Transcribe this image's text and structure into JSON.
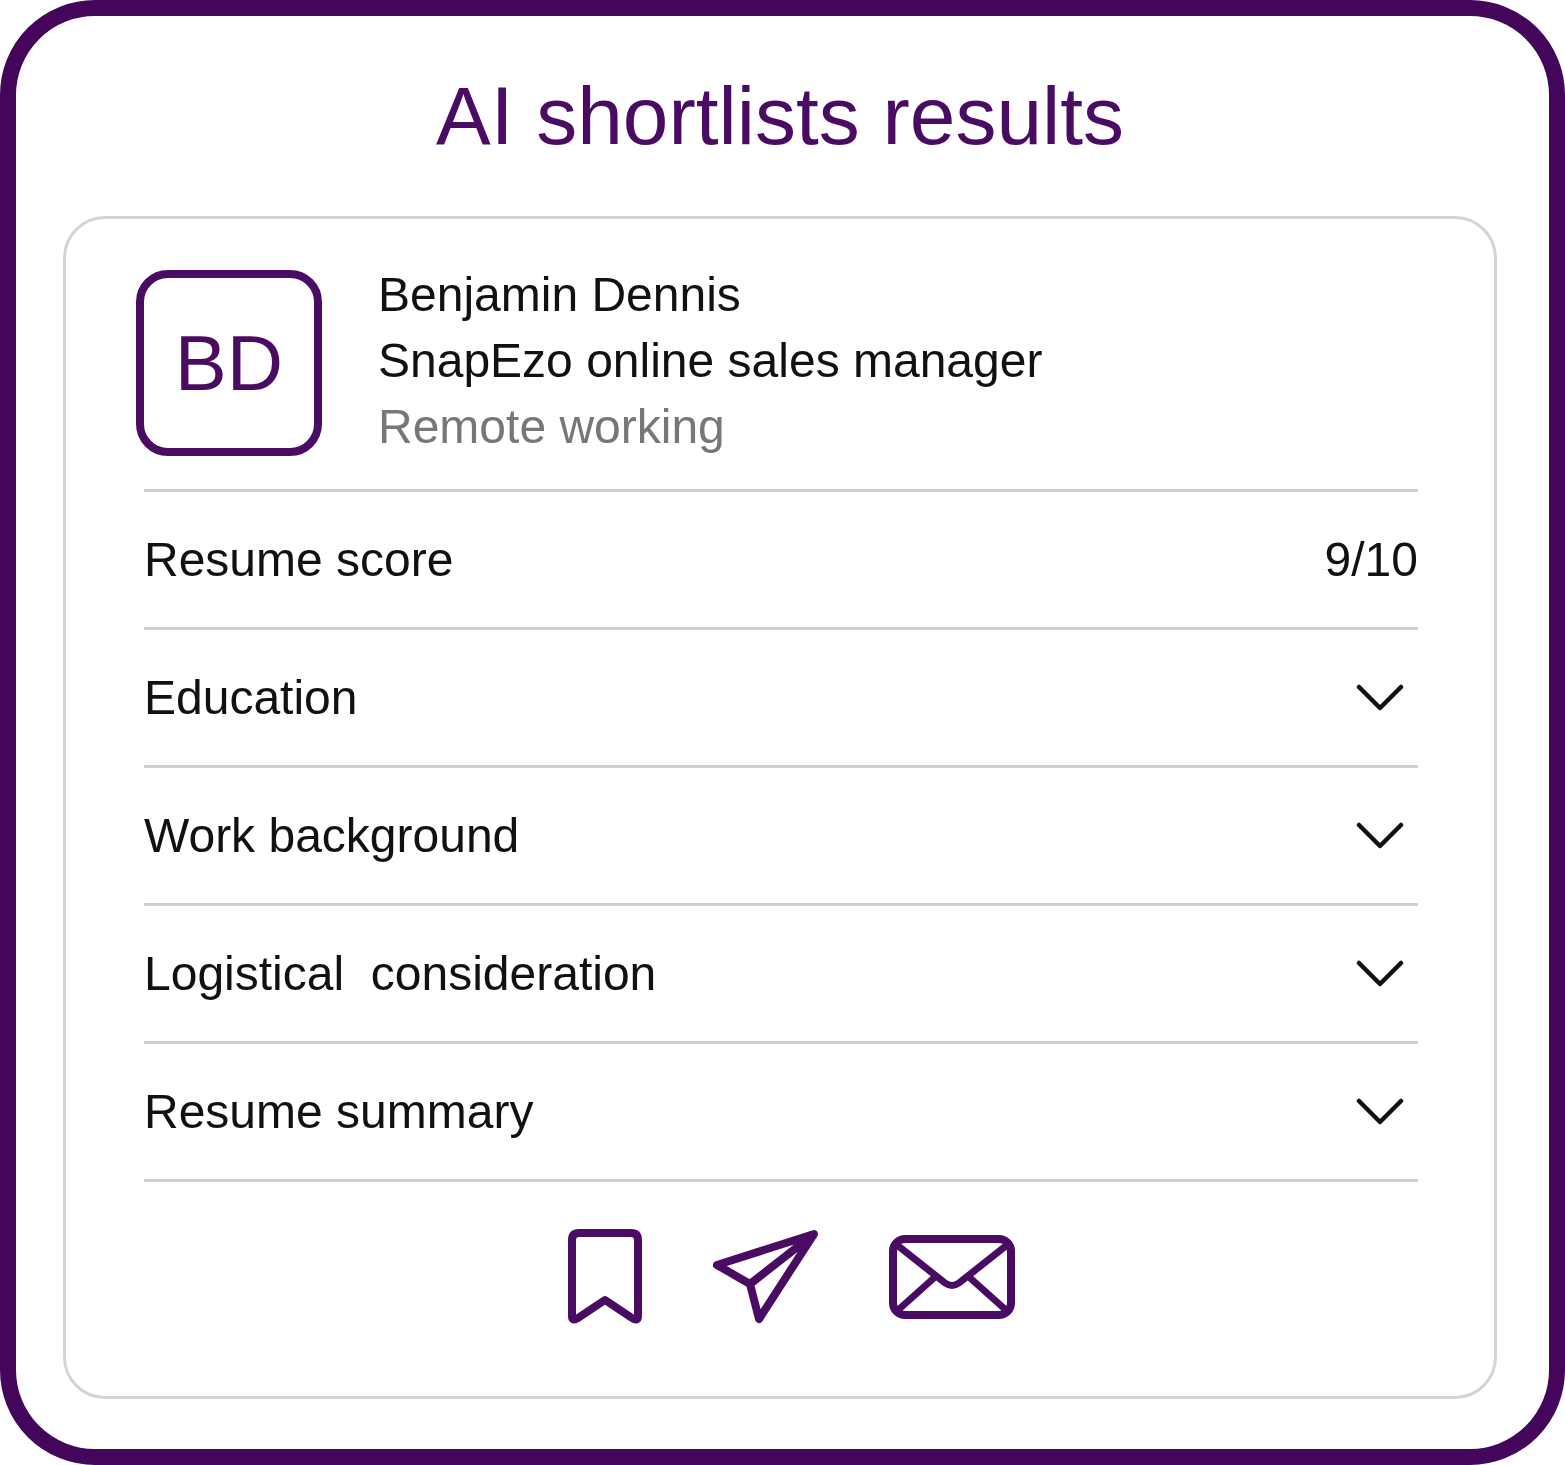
{
  "title": "AI shortlists results",
  "candidate": {
    "initials": "BD",
    "name": "Benjamin Dennis",
    "role": "SnapEzo online sales manager",
    "location": "Remote working"
  },
  "rows": [
    {
      "kind": "score",
      "label": "Resume score",
      "value": "9/10"
    },
    {
      "kind": "expandable",
      "label": "Education",
      "expanded": false
    },
    {
      "kind": "expandable",
      "label": "Work background",
      "expanded": false
    },
    {
      "kind": "expandable",
      "label": "Logistical  consideration",
      "expanded": false
    },
    {
      "kind": "expandable",
      "label": "Resume summary",
      "expanded": false
    }
  ]
}
